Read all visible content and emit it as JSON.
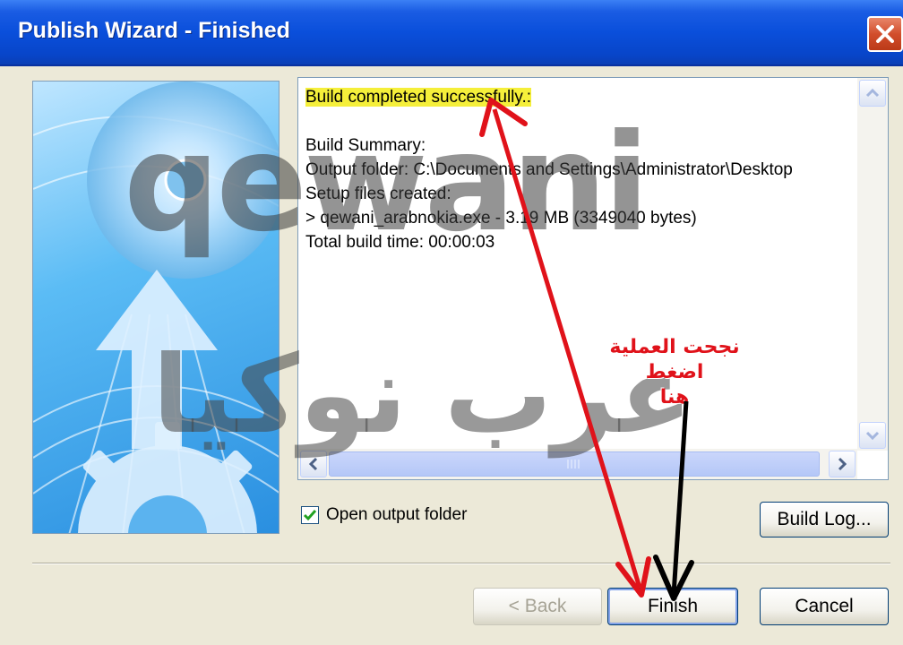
{
  "window": {
    "title": "Publish Wizard - Finished",
    "close_icon": "close-icon"
  },
  "log": {
    "status": "Build completed successfully.:",
    "lines": [
      "Build Summary:",
      "Output folder: C:\\Documents and Settings\\Administrator\\Desktop",
      "Setup files created:",
      "> qewani_arabnokia.exe - 3.19 MB (3349040 bytes)",
      "Total build time: 00:00:03"
    ]
  },
  "options": {
    "open_output_label": "Open output folder",
    "open_output_checked": true
  },
  "buttons": {
    "build_log": "Build Log...",
    "back": "< Back",
    "finish": "Finish",
    "cancel": "Cancel"
  },
  "watermark": {
    "latin": "qewani",
    "arabic": "عرب نوكيا"
  },
  "annotation": {
    "text_line1": "نجحت العملية اضغط",
    "text_line2": "هنا"
  },
  "colors": {
    "title_bar": "#0a4fdb",
    "highlight": "#f5ef3a",
    "arrow_red": "#e0121a",
    "arrow_black": "#000000"
  }
}
